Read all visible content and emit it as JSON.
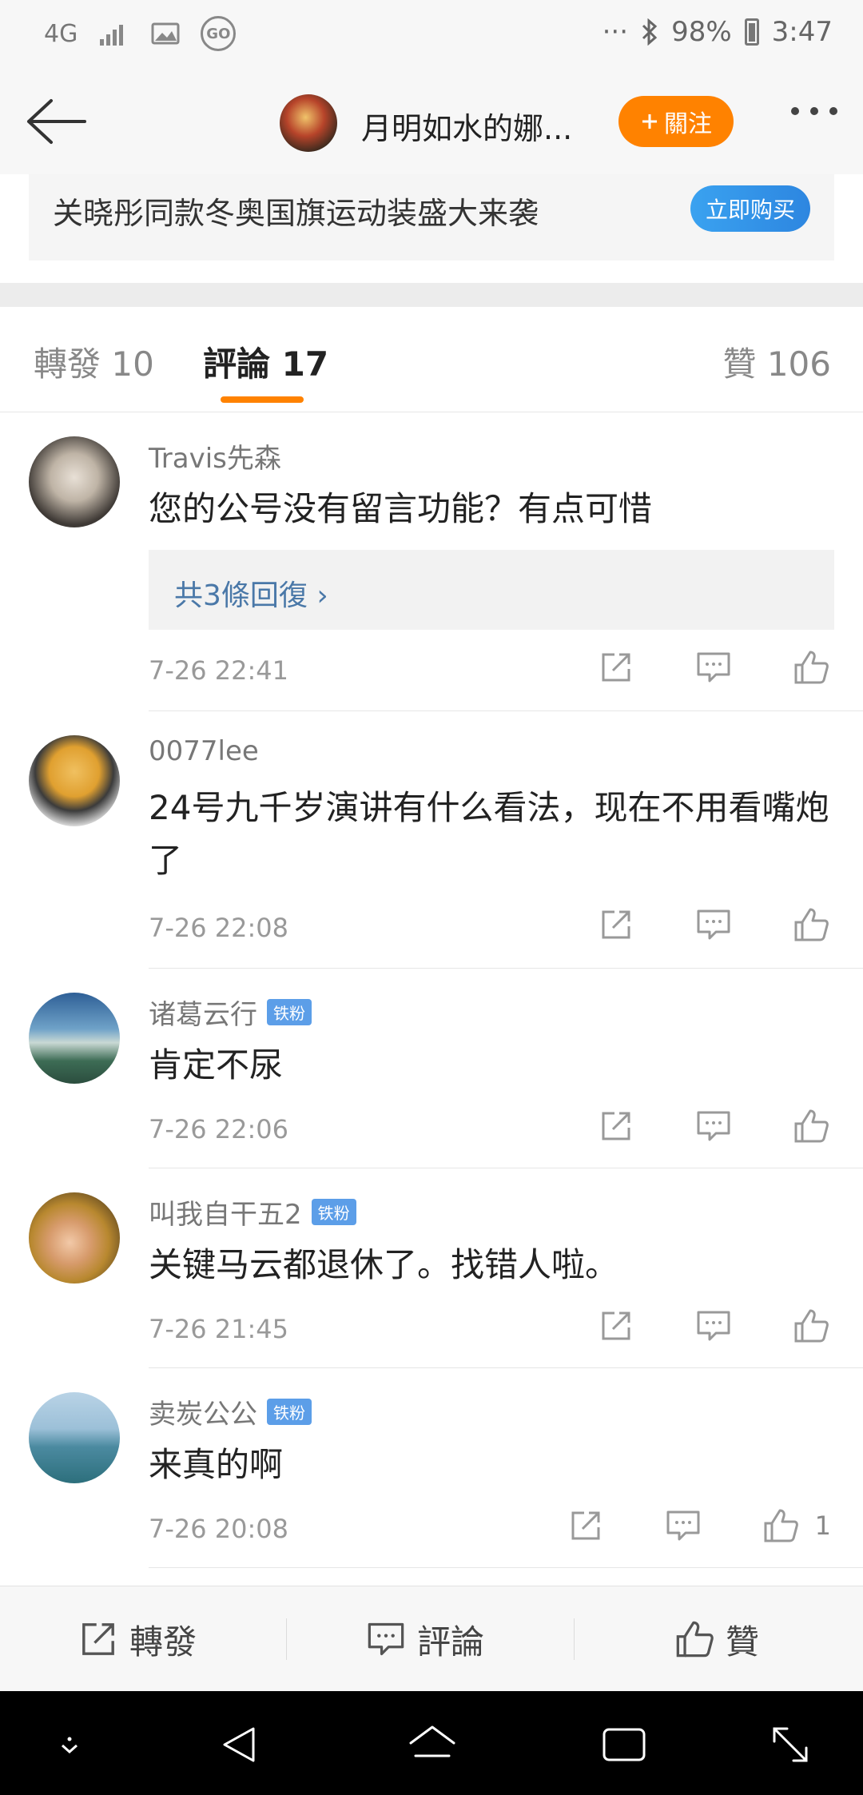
{
  "status_bar": {
    "network": "4G",
    "battery": "98%",
    "time": "3:47",
    "more": "···"
  },
  "header": {
    "title": "月明如水的娜...",
    "follow_label": "關注"
  },
  "ad": {
    "text": "关晓彤同款冬奥国旗运动装盛大来袭",
    "button": "立即购买"
  },
  "tabs": {
    "repost": "轉發 10",
    "comments": "評論 17",
    "likes": "贊 106"
  },
  "comments": [
    {
      "user": "Travis先森",
      "text": "您的公号没有留言功能？有点可惜",
      "reply": "共3條回復 ›",
      "time": "7-26 22:41"
    },
    {
      "user": "0077lee",
      "text": "24号九千岁演讲有什么看法，现在不用看嘴炮了",
      "time": "7-26 22:08"
    },
    {
      "user": "诸葛云行",
      "badge": "铁粉",
      "text": "肯定不尿",
      "time": "7-26 22:06"
    },
    {
      "user": "叫我自干五2",
      "badge": "铁粉",
      "text": "关键马云都退休了。找错人啦。",
      "time": "7-26 21:45"
    },
    {
      "user": "卖炭公公",
      "badge": "铁粉",
      "text": "来真的啊",
      "time": "7-26 20:08",
      "likes": "1"
    }
  ],
  "bottom_bar": {
    "repost": "轉發",
    "comment": "評論",
    "like": "贊"
  },
  "colors": {
    "accent": "#ff8200",
    "link": "#4a78a8",
    "ad_button": "#2d86e0",
    "badge": "#5c9ee8"
  }
}
